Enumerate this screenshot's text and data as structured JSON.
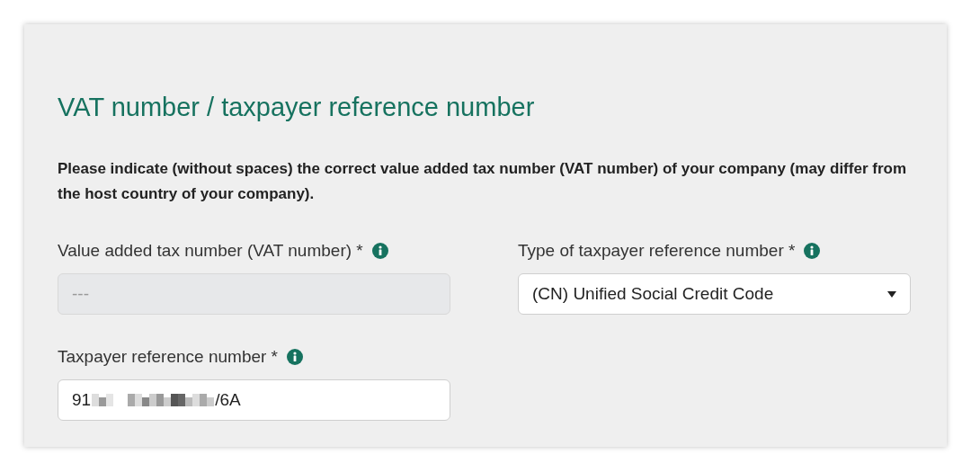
{
  "title": "VAT number / taxpayer reference number",
  "instructions": "Please indicate (without spaces) the correct value added tax number (VAT number) of your company (may differ from the host country of your company).",
  "fields": [
    {
      "kind": "text",
      "label": "Value added tax number (VAT number) *",
      "placeholder": "---",
      "disabled": true
    },
    {
      "kind": "select",
      "label": "Type of taxpayer reference number *",
      "value": "(CN) Unified Social Credit Code",
      "disabled": false
    },
    {
      "kind": "redacted",
      "label": "Taxpayer reference number *",
      "value_start": "91",
      "value_end": "/6A",
      "disabled": false
    }
  ]
}
